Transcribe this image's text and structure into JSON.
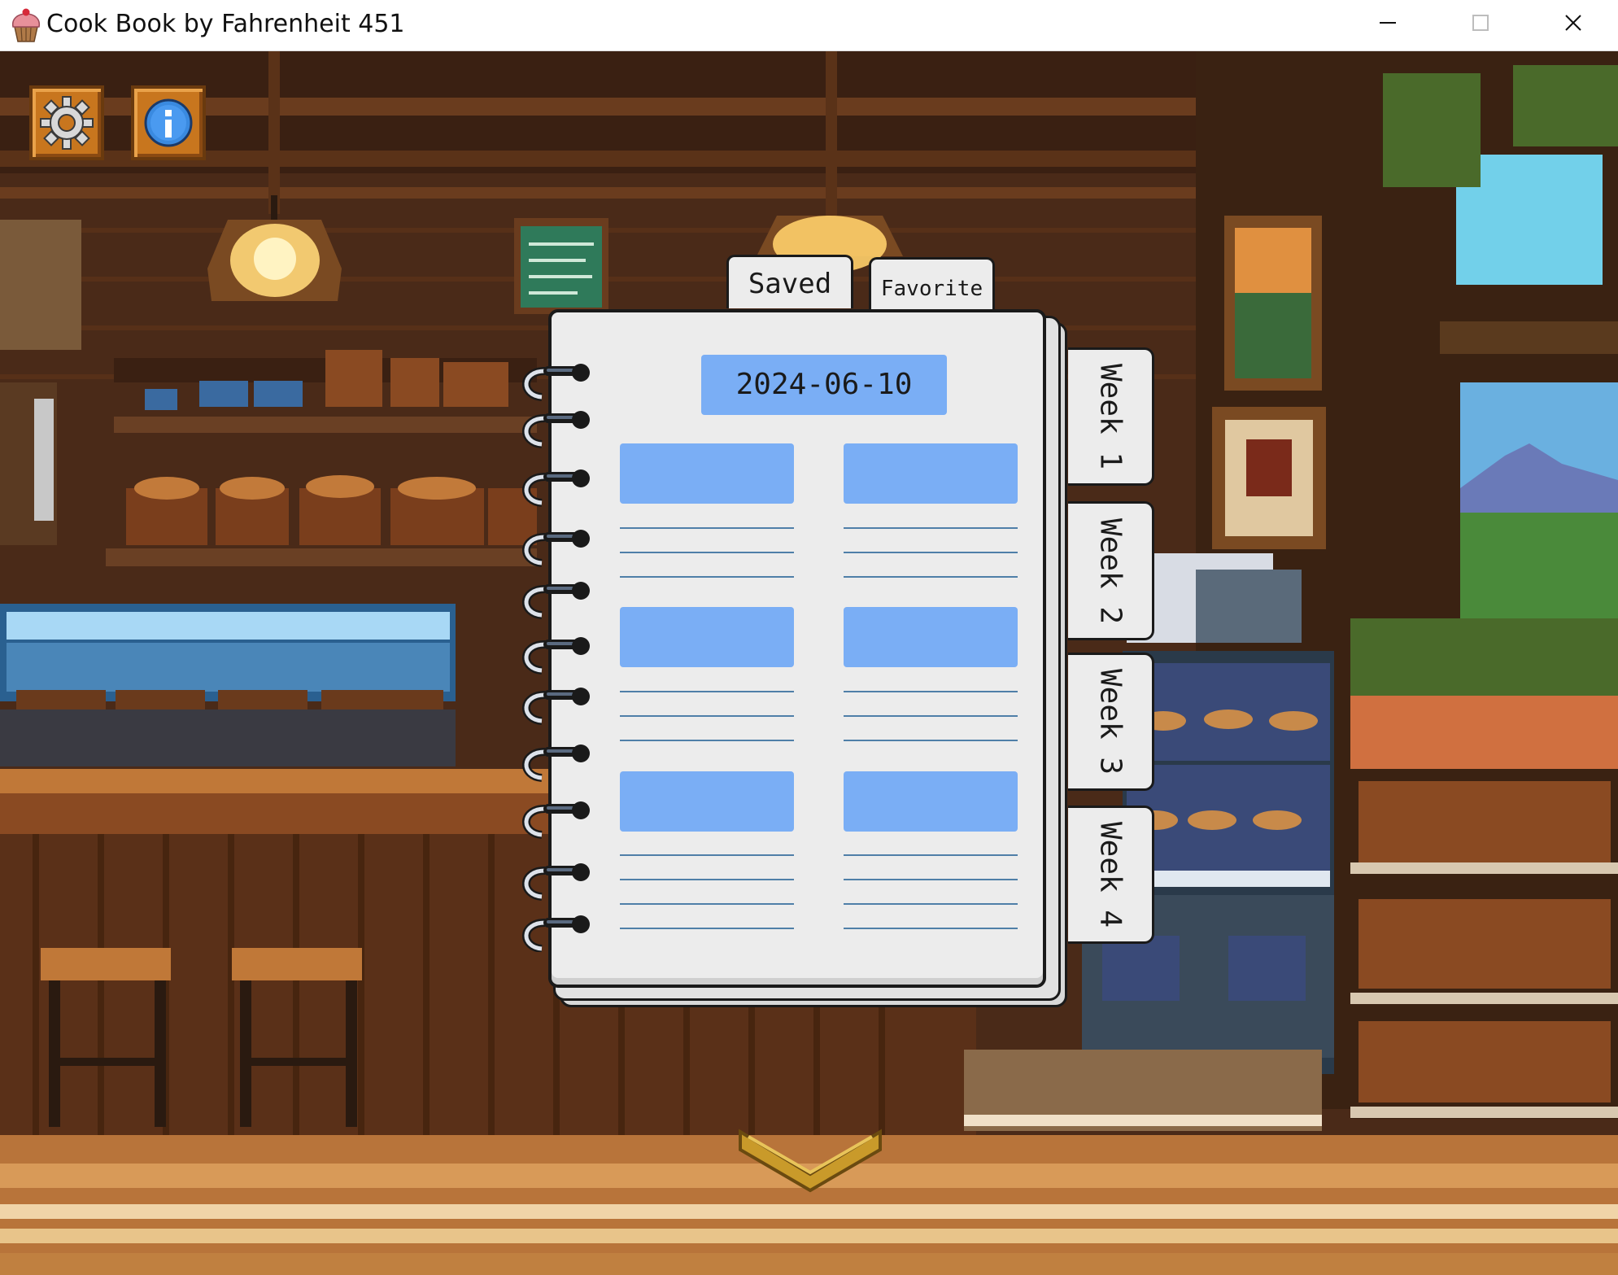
{
  "window": {
    "title": "Cook Book by Fahrenheit 451",
    "icon": "cupcake-icon",
    "controls": [
      "minimize-icon",
      "maximize-icon",
      "close-icon"
    ]
  },
  "toolbar": {
    "settings_icon": "gear-icon",
    "info_icon": "info-icon"
  },
  "notebook": {
    "tabs": [
      {
        "label": "Saved"
      },
      {
        "label": "Favorite"
      }
    ],
    "date": "2024-06-10",
    "week_tabs": [
      {
        "label": "Week 1"
      },
      {
        "label": "Week 2"
      },
      {
        "label": "Week 3"
      },
      {
        "label": "Week 4"
      }
    ]
  },
  "navigation": {
    "scroll_icon": "chevron-down-icon"
  },
  "colors": {
    "accent_blue": "#7aaef5",
    "page": "#ececec",
    "button_orange": "#c8761e"
  }
}
